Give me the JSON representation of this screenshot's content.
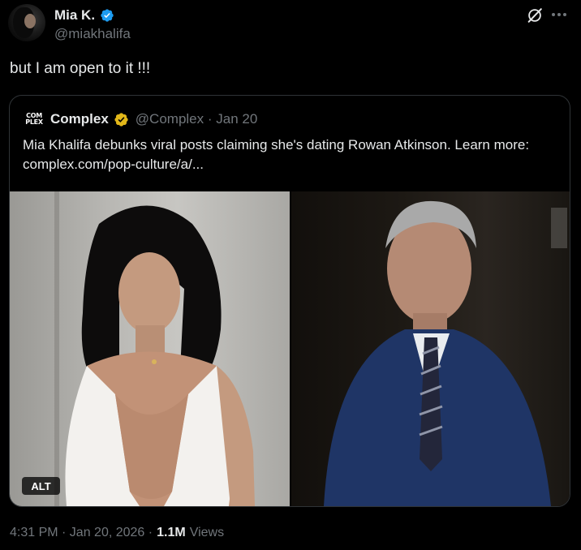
{
  "author": {
    "display_name": "Mia K.",
    "handle": "@miakhalifa",
    "verified": true,
    "verified_color": "#1d9bf0"
  },
  "tweet": {
    "text": "but I am open to it !!!"
  },
  "quote": {
    "logo_top": "COM",
    "logo_bottom": "PLEX",
    "display_name": "Complex",
    "verified_color": "#e2b719",
    "handle_date": "@Complex · Jan 20",
    "text": "Mia Khalifa debunks viral posts claiming she's dating Rowan Atkinson. Learn more: complex.com/pop-culture/a/...",
    "alt_label": "ALT"
  },
  "meta": {
    "time_date": "4:31 PM · Jan 20, 2026 ·",
    "views_count": "1.1M",
    "views_label": "Views"
  },
  "colors": {
    "background": "#000000",
    "text": "#e7e9ea",
    "muted": "#71767b",
    "border": "#2f3336"
  }
}
